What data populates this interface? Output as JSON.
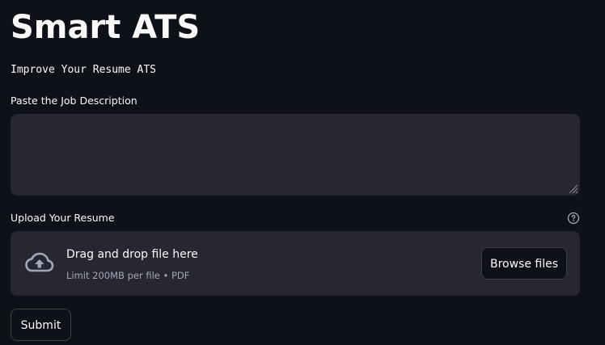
{
  "app": {
    "title": "Smart ATS",
    "subtitle": "Improve Your Resume ATS"
  },
  "job_description": {
    "label": "Paste the Job Description",
    "value": "",
    "placeholder": ""
  },
  "resume_upload": {
    "label": "Upload Your Resume",
    "help_icon": "question-circle-icon",
    "upload_icon": "cloud-upload-icon",
    "dropzone_text": "Drag and drop file here",
    "limit_text": "Limit 200MB per file • PDF",
    "browse_label": "Browse files"
  },
  "actions": {
    "submit_label": "Submit"
  },
  "colors": {
    "background": "#0e1117",
    "surface": "#262730",
    "text": "#fafafa",
    "muted_text": "#a3a8b8"
  }
}
